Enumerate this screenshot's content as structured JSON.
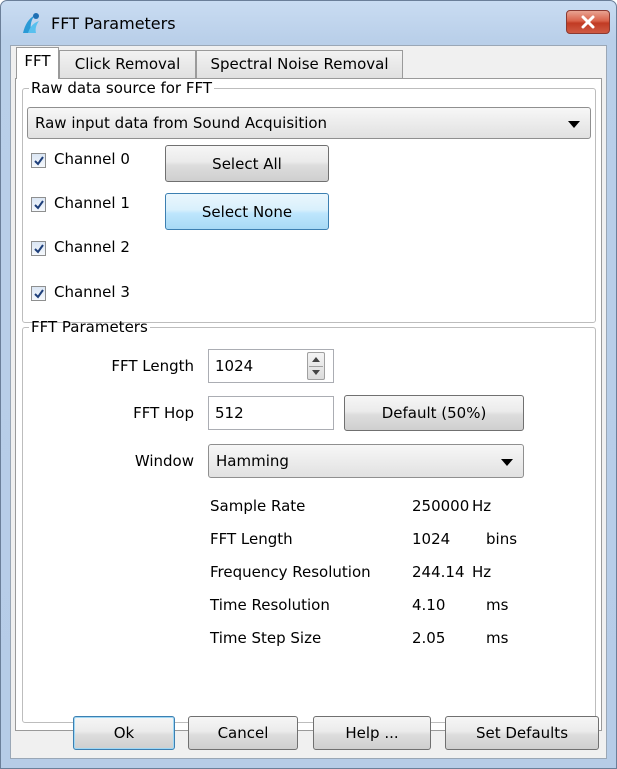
{
  "window": {
    "title": "FFT Parameters"
  },
  "tabs": [
    {
      "label": "FFT",
      "active": true
    },
    {
      "label": "Click Removal",
      "active": false
    },
    {
      "label": "Spectral Noise Removal",
      "active": false
    }
  ],
  "raw_source": {
    "legend": "Raw data source for FFT",
    "selected": "Raw input data from Sound Acquisition",
    "channels": [
      {
        "label": "Channel 0",
        "checked": true
      },
      {
        "label": "Channel 1",
        "checked": true
      },
      {
        "label": "Channel 2",
        "checked": true
      },
      {
        "label": "Channel 3",
        "checked": true
      }
    ],
    "select_all_label": "Select All",
    "select_none_label": "Select None"
  },
  "fft_params": {
    "legend": "FFT Parameters",
    "fft_length_label": "FFT Length",
    "fft_length_value": "1024",
    "fft_hop_label": "FFT Hop",
    "fft_hop_value": "512",
    "default_button_label": "Default (50%)",
    "window_label": "Window",
    "window_selected": "Hamming",
    "info_rows": [
      {
        "name": "Sample Rate",
        "value": "250000",
        "unit": "Hz"
      },
      {
        "name": "FFT Length",
        "value": "1024",
        "unit": "bins"
      },
      {
        "name": "Frequency Resolution",
        "value": "244.14",
        "unit": "Hz"
      },
      {
        "name": "Time Resolution",
        "value": "4.10",
        "unit": "ms"
      },
      {
        "name": "Time Step Size",
        "value": "2.05",
        "unit": "ms"
      }
    ]
  },
  "footer": {
    "ok_label": "Ok",
    "cancel_label": "Cancel",
    "help_label": "Help ...",
    "set_defaults_label": "Set Defaults"
  },
  "icons": {
    "app": "pamguard-logo-icon",
    "close": "close-icon",
    "checkbox": "checkmark-icon",
    "dropdown": "chevron-down-icon",
    "spinner": "spinner-arrows-icon"
  },
  "colors": {
    "titlebar": "#c9dcf2",
    "close_button": "#c94a34",
    "focus_button": "#bee6fd"
  }
}
